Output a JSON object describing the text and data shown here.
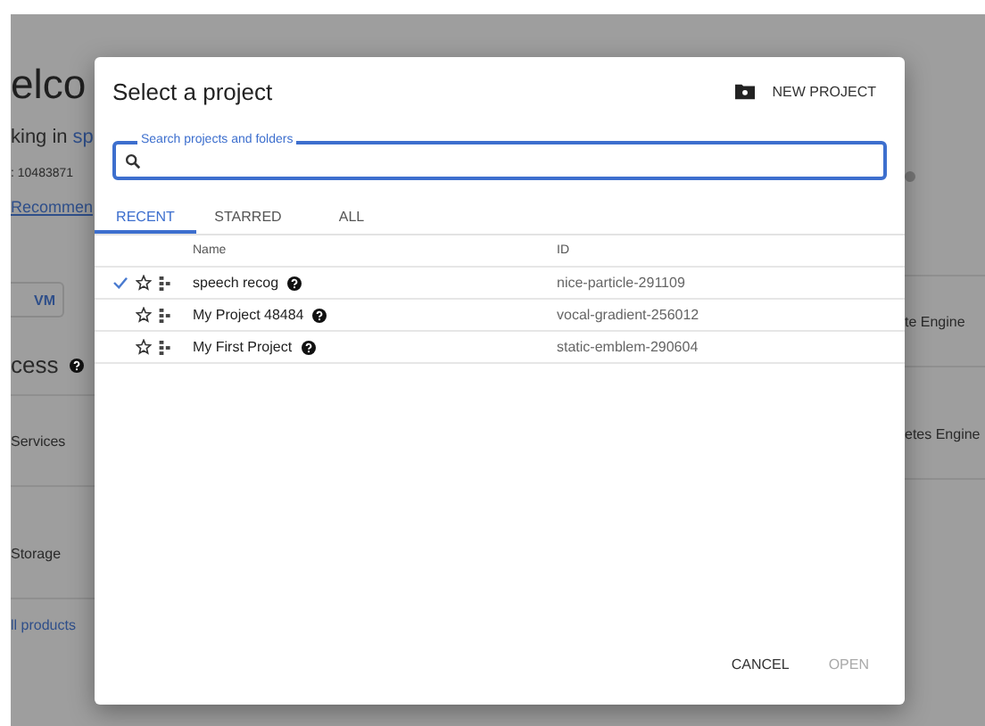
{
  "background_page": {
    "heading": "elco",
    "working_in_label": "king in",
    "project_link": "sp",
    "number": ": 10483871",
    "recommendations_link": "Recommen",
    "vm_button": "VM",
    "access_heading": "cess",
    "left_items": [
      "Services",
      "Storage"
    ],
    "all_products_link": "ll products",
    "right_items": [
      "te Engine",
      "etes Engine"
    ]
  },
  "dialog": {
    "title": "Select a project",
    "new_project_button": "NEW PROJECT",
    "search": {
      "placeholder": "Search projects and folders"
    },
    "tabs": [
      {
        "label": "RECENT",
        "selected": true
      },
      {
        "label": "STARRED",
        "selected": false
      },
      {
        "label": "ALL",
        "selected": false
      }
    ],
    "table": {
      "columns": [
        "Name",
        "ID"
      ],
      "rows": [
        {
          "name": "speech recog",
          "id": "nice-particle-291109",
          "selected": true,
          "starred": false
        },
        {
          "name": "My Project 48484",
          "id": "vocal-gradient-256012",
          "selected": false,
          "starred": false
        },
        {
          "name": "My First Project",
          "id": "static-emblem-290604",
          "selected": false,
          "starred": false
        }
      ]
    },
    "buttons": [
      {
        "label": "CANCEL",
        "disabled": false
      },
      {
        "label": "OPEN",
        "disabled": true
      }
    ]
  }
}
